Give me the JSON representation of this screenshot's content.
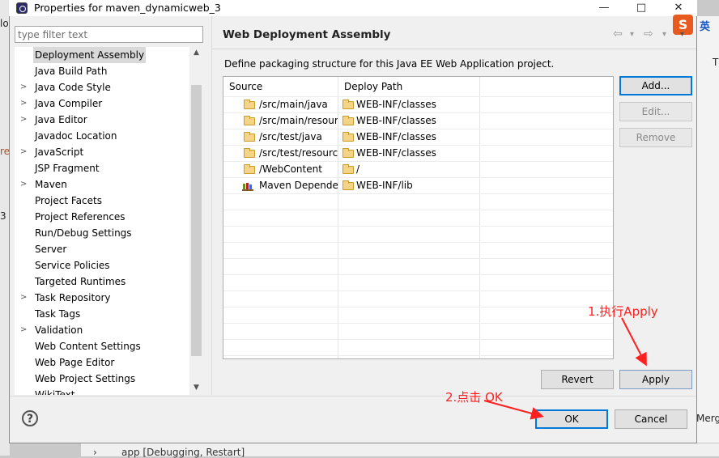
{
  "window": {
    "title": "Properties for maven_dynamicweb_3",
    "minimize": "—",
    "maximize": "□",
    "close": "✕"
  },
  "filter": {
    "placeholder": "type filter text"
  },
  "tree": {
    "items": [
      {
        "label": "Deployment Assembly",
        "expandable": false,
        "selected": true
      },
      {
        "label": "Java Build Path",
        "expandable": false
      },
      {
        "label": "Java Code Style",
        "expandable": true
      },
      {
        "label": "Java Compiler",
        "expandable": true
      },
      {
        "label": "Java Editor",
        "expandable": true
      },
      {
        "label": "Javadoc Location",
        "expandable": false
      },
      {
        "label": "JavaScript",
        "expandable": true
      },
      {
        "label": "JSP Fragment",
        "expandable": false
      },
      {
        "label": "Maven",
        "expandable": true
      },
      {
        "label": "Project Facets",
        "expandable": false
      },
      {
        "label": "Project References",
        "expandable": false
      },
      {
        "label": "Run/Debug Settings",
        "expandable": false
      },
      {
        "label": "Server",
        "expandable": false
      },
      {
        "label": "Service Policies",
        "expandable": false
      },
      {
        "label": "Targeted Runtimes",
        "expandable": false
      },
      {
        "label": "Task Repository",
        "expandable": true
      },
      {
        "label": "Task Tags",
        "expandable": false
      },
      {
        "label": "Validation",
        "expandable": true
      },
      {
        "label": "Web Content Settings",
        "expandable": false
      },
      {
        "label": "Web Page Editor",
        "expandable": false
      },
      {
        "label": "Web Project Settings",
        "expandable": false
      },
      {
        "label": "WikiText",
        "expandable": false
      }
    ]
  },
  "page": {
    "title": "Web Deployment Assembly",
    "description": "Define packaging structure for this Java EE Web Application project.",
    "nav_back": "⇦",
    "nav_forward": "⇨",
    "nav_dropdown": "▾",
    "menu": "▾"
  },
  "table": {
    "columns": [
      "Source",
      "Deploy Path"
    ],
    "rows": [
      {
        "source": "/src/main/java",
        "deploy": "WEB-INF/classes",
        "icon": "folder-icon"
      },
      {
        "source": "/src/main/resour",
        "deploy": "WEB-INF/classes",
        "icon": "folder-icon"
      },
      {
        "source": "/src/test/java",
        "deploy": "WEB-INF/classes",
        "icon": "folder-icon"
      },
      {
        "source": "/src/test/resourc",
        "deploy": "WEB-INF/classes",
        "icon": "folder-icon"
      },
      {
        "source": "/WebContent",
        "deploy": "/",
        "icon": "folder-icon"
      },
      {
        "source": "Maven Depende",
        "deploy": "WEB-INF/lib",
        "icon": "library-icon"
      }
    ]
  },
  "buttons": {
    "add": "Add...",
    "edit": "Edit...",
    "remove": "Remove",
    "revert": "Revert",
    "apply": "Apply",
    "ok": "OK",
    "cancel": "Cancel",
    "help": "?"
  },
  "annotations": {
    "step1": "1.执行Apply",
    "step2": "2.点击 OK",
    "color": "#ff2020"
  },
  "background": {
    "debug_line": "app  [Debugging, Restart]",
    "merge_text": "Merg",
    "ime_logo": "S",
    "ime_label": "英",
    "edge_text_1": "lo",
    "edge_text_2": "re",
    "edge_text_3": "3",
    "edge_text_4": "T"
  }
}
